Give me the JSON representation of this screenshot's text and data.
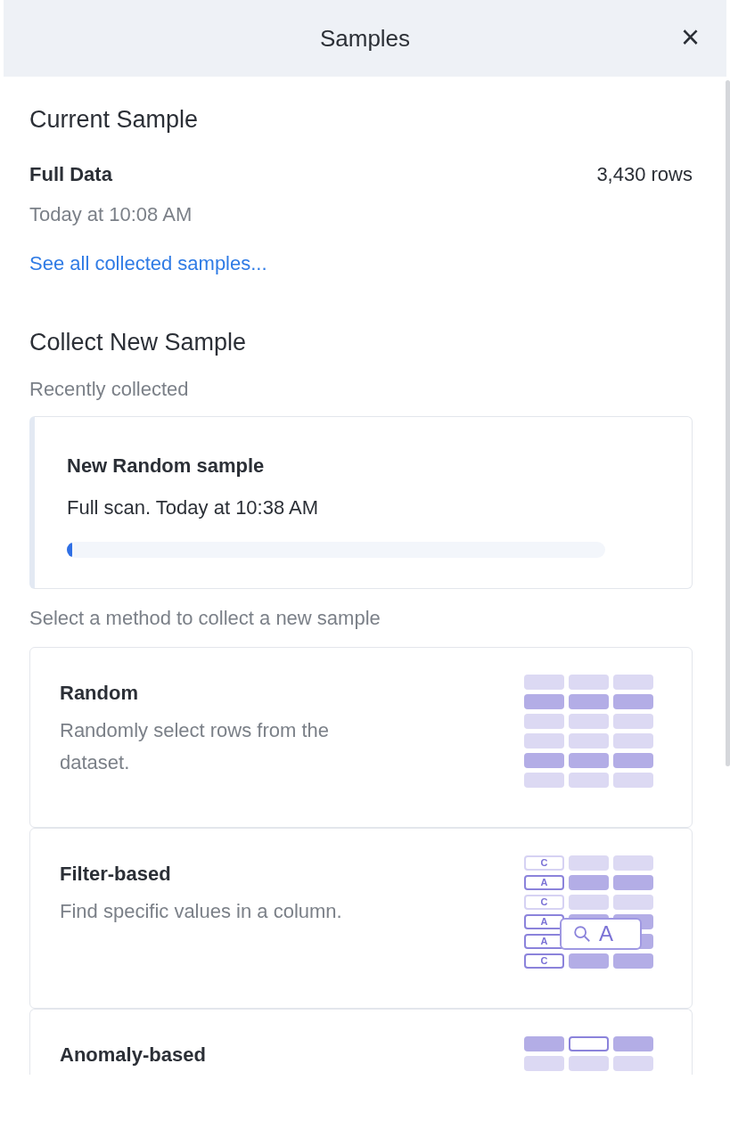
{
  "header": {
    "title": "Samples",
    "close": "×"
  },
  "current_sample": {
    "heading": "Current Sample",
    "name": "Full Data",
    "rows": "3,430 rows",
    "time": "Today at 10:08 AM",
    "link": "See all collected samples..."
  },
  "collect": {
    "heading": "Collect New Sample",
    "recent_label": "Recently collected",
    "recent": {
      "title": "New Random sample",
      "subtitle": "Full scan. Today at 10:38 AM",
      "level": 0.01
    },
    "methods_label": "Select a method to collect a new sample",
    "methods": [
      {
        "kind": "random",
        "title": "Random",
        "description": "Randomly select rows from the dataset."
      },
      {
        "kind": "filter",
        "title": "Filter-based",
        "description": "Find specific values in a column.",
        "tags": [
          "C",
          "A",
          "C",
          "A",
          "A",
          "C"
        ],
        "search_label": "A"
      },
      {
        "kind": "anomaly",
        "title": "Anomaly-based"
      }
    ]
  }
}
